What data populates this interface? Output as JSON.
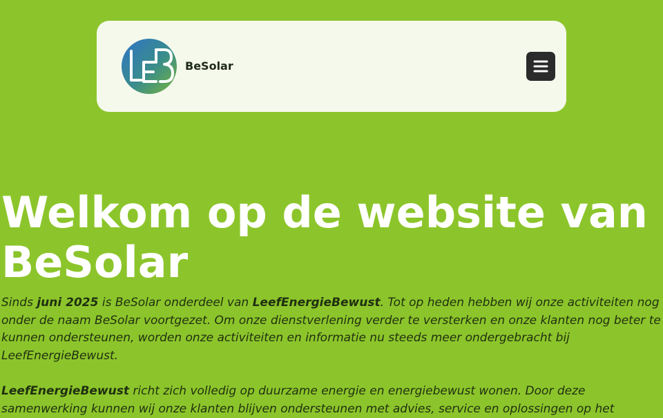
{
  "header": {
    "brand_name": "BeSolar",
    "logo_text": "LEB",
    "menu_icon": "hamburger-icon"
  },
  "hero": {
    "title": "Welkom op de website van BeSolar"
  },
  "intro": {
    "part1": "Sinds ",
    "date": "juni 2025",
    "part2": " is BeSolar onderdeel van ",
    "org": "LeefEnergieBewust",
    "part3": ". Tot op heden hebben wij onze activiteiten nog onder de naam BeSolar voortgezet. Om onze dienstverlening verder te versterken en onze klanten nog beter te kunnen ondersteunen, worden onze activiteiten en informatie nu steeds meer ondergebracht bij LeefEnergieBewust."
  },
  "paragraph2": {
    "org": "LeefEnergieBewust",
    "text": " richt zich volledig op duurzame energie en energiebewust wonen. Door deze samenwerking kunnen wij onze klanten blijven ondersteunen met advies, service en oplossingen op het"
  },
  "colors": {
    "background": "#8cc52b",
    "header_card": "#f5f9ec",
    "menu_button": "#2b2b2b",
    "hero_text": "#ffffff",
    "body_text": "#1f2f10"
  }
}
